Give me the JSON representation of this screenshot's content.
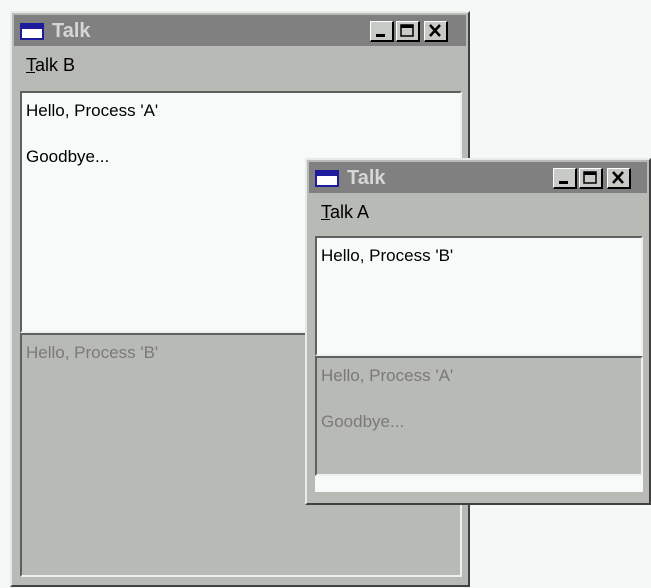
{
  "window_b": {
    "title": "Talk",
    "menu": {
      "label": "Talk B",
      "accel": "T",
      "rest": "alk B"
    },
    "send_pane": {
      "lines": [
        "Hello, Process 'A'",
        "",
        "Goodbye..."
      ]
    },
    "receive_pane": {
      "lines": [
        "Hello, Process 'B'"
      ]
    }
  },
  "window_a": {
    "title": "Talk",
    "menu": {
      "label": "Talk A",
      "accel": "T",
      "rest": "alk A"
    },
    "send_pane": {
      "lines": [
        "Hello, Process 'B'"
      ]
    },
    "receive_pane": {
      "lines": [
        "Hello, Process 'A'",
        "",
        "Goodbye..."
      ]
    }
  },
  "colors": {
    "titlebar_inactive": "#808080",
    "window_face": "#b8bab6",
    "desktop": "#f4f8f6"
  },
  "icons": [
    "app-window-icon",
    "minimize-icon",
    "maximize-icon",
    "close-icon"
  ]
}
